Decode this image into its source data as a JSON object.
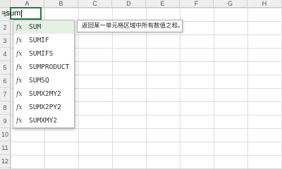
{
  "columns": [
    "A",
    "B",
    "C",
    "D",
    "E",
    "F",
    "G",
    "H"
  ],
  "rows": [
    "1",
    "2",
    "3",
    "4",
    "5",
    "6",
    "7",
    "8",
    "9",
    "10",
    "11",
    "12"
  ],
  "active_cell": {
    "value": "=sum"
  },
  "autocomplete": {
    "icon_text": "fx",
    "items": [
      {
        "name": "SUM",
        "selected": true
      },
      {
        "name": "SUMIF"
      },
      {
        "name": "SUMIFS"
      },
      {
        "name": "SUMPRODUCT"
      },
      {
        "name": "SUMSQ"
      },
      {
        "name": "SUMX2MY2"
      },
      {
        "name": "SUMX2PY2"
      },
      {
        "name": "SUMXMY2"
      }
    ]
  },
  "tooltip": {
    "text": "返回某一单元格区域中所有数值之和。"
  },
  "colors": {
    "accent": "#1e7a45",
    "selected_bg": "#e6f1e3"
  }
}
